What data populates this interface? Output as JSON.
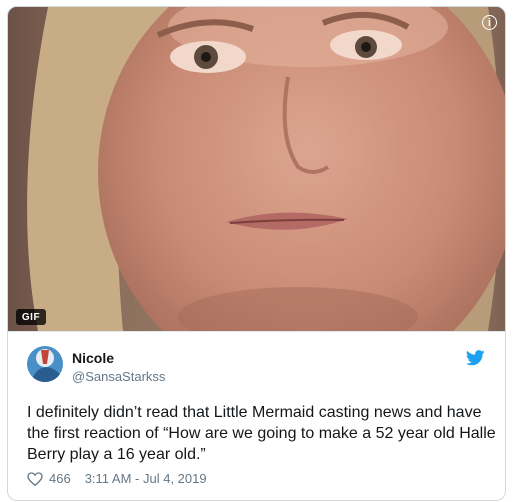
{
  "media": {
    "badge": "GIF",
    "info_glyph": "i",
    "info_icon": "info-circle-icon"
  },
  "tweet": {
    "display_name": "Nicole",
    "handle": "@SansaStarkss",
    "text": "I definitely didn’t read that Little Mermaid casting news and have the first reaction of “How are we going to make a 52 year old Halle Berry play a 16 year old.”",
    "likes": "466",
    "timestamp": "3:11 AM - Jul 4, 2019",
    "bird_icon": "twitter-bird-icon",
    "heart_icon": "heart-outline-icon",
    "brand_color": "#1da1f2"
  }
}
